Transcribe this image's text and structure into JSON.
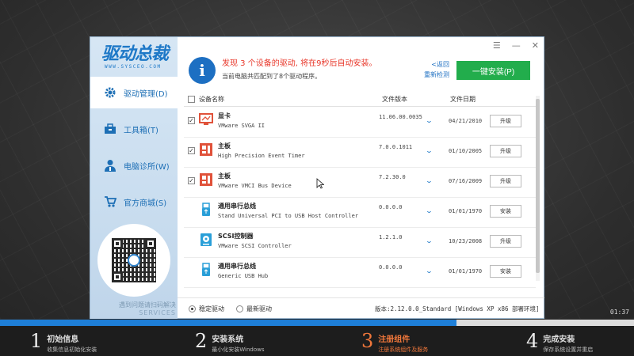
{
  "window": {
    "logo_text": "驱动总裁",
    "logo_url": "WWW.SYSCEO.COM",
    "controls": {
      "menu": "☰",
      "minimize": "—",
      "close": "✕"
    }
  },
  "sidebar": {
    "items": [
      {
        "label": "驱动管理(D)",
        "icon": "gear-icon",
        "active": true
      },
      {
        "label": "工具箱(T)",
        "icon": "toolbox-icon",
        "active": false
      },
      {
        "label": "电脑诊所(W)",
        "icon": "doctor-icon",
        "active": false
      },
      {
        "label": "官方商城(S)",
        "icon": "cart-icon",
        "active": false
      }
    ],
    "help_text": "遇到问题请扫码解决",
    "help_sub": "SERVICES"
  },
  "header": {
    "notice": "发现 3 个设备的驱动, 将在9秒后自动安装。",
    "sub_notice": "当前电脑共匹配到了8个驱动程序。",
    "back_link": "<返回",
    "rescan_link": "重新检测",
    "install_button": "一键安装(P)"
  },
  "table": {
    "columns": {
      "name": "设备名称",
      "version": "文件版本",
      "date": "文件日期"
    },
    "rows": [
      {
        "checked": true,
        "icon": "monitor-icon",
        "category": "显卡",
        "name": "VMware SVGA II",
        "version": "11.06.00.0035",
        "date": "04/21/2010",
        "action": "升级",
        "has_checkbox": true
      },
      {
        "checked": true,
        "icon": "motherboard-icon",
        "category": "主板",
        "name": "High Precision Event Timer",
        "version": "7.0.0.1011",
        "date": "01/10/2005",
        "action": "升级",
        "has_checkbox": true
      },
      {
        "checked": true,
        "icon": "motherboard-icon",
        "category": "主板",
        "name": "VMware VMCI Bus Device",
        "version": "7.2.30.0",
        "date": "07/16/2009",
        "action": "升级",
        "has_checkbox": true
      },
      {
        "checked": false,
        "icon": "usb-icon",
        "category": "通用串行总线",
        "name": "Stand Universal PCI to USB Host Controller",
        "version": "0.0.0.0",
        "date": "01/01/1970",
        "action": "安装",
        "has_checkbox": false
      },
      {
        "checked": false,
        "icon": "scsi-icon",
        "category": "SCSI控制器",
        "name": "VMware SCSI Controller",
        "version": "1.2.1.0",
        "date": "10/23/2008",
        "action": "升级",
        "has_checkbox": false
      },
      {
        "checked": false,
        "icon": "usb-icon",
        "category": "通用串行总线",
        "name": "Generic USB Hub",
        "version": "0.0.0.0",
        "date": "01/01/1970",
        "action": "安装",
        "has_checkbox": false
      }
    ]
  },
  "footer": {
    "stable_label": "稳定驱动",
    "latest_label": "最新驱动",
    "version_info": "版本:2.12.0.0_Standard [Windows XP x86 部署环境]"
  },
  "clock": "01:37",
  "installer": {
    "progress_fraction": 0.72,
    "steps": [
      {
        "num": "1",
        "title": "初始信息",
        "sub": "收集信息初始化安装",
        "active": false
      },
      {
        "num": "2",
        "title": "安装系统",
        "sub": "最小化安装Windows",
        "active": false
      },
      {
        "num": "3",
        "title": "注册组件",
        "sub": "注册系统组件及服务",
        "active": true
      },
      {
        "num": "4",
        "title": "完成安装",
        "sub": "保存系统设置并重启",
        "active": false
      }
    ]
  },
  "colors": {
    "accent": "#1d6fc2",
    "install_green": "#22ad4c",
    "alert_red": "#e8382b",
    "step_active": "#f0773b"
  }
}
